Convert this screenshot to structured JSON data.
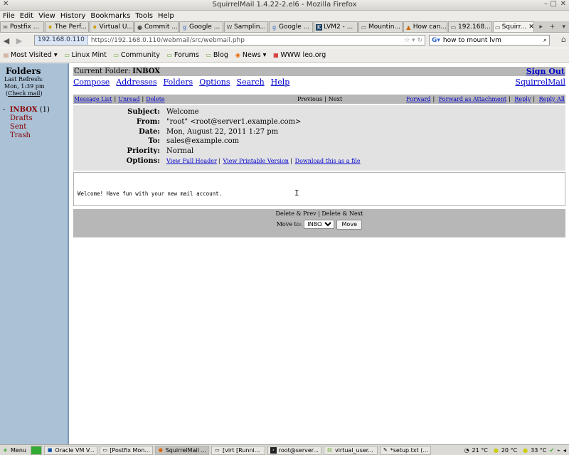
{
  "window": {
    "title": "SquirrelMail 1.4.22-2.el6 - Mozilla Firefox"
  },
  "menubar": {
    "items": [
      "File",
      "Edit",
      "View",
      "History",
      "Bookmarks",
      "Tools",
      "Help"
    ]
  },
  "tabs": [
    {
      "label": "Postfix ...",
      "icon": "postfix-icon"
    },
    {
      "label": "The Perf...",
      "icon": "bulb-icon"
    },
    {
      "label": "Virtual U...",
      "icon": "bulb-icon"
    },
    {
      "label": "Commit ...",
      "icon": "github-icon"
    },
    {
      "label": "Google ...",
      "icon": "google-icon"
    },
    {
      "label": "Samplin...",
      "icon": "wikipedia-icon"
    },
    {
      "label": "Google ...",
      "icon": "google-icon"
    },
    {
      "label": "LVM2 - ...",
      "icon": "k-icon"
    },
    {
      "label": "Mountin...",
      "icon": "page-icon"
    },
    {
      "label": "How can...",
      "icon": "warning-icon"
    },
    {
      "label": "192.168...",
      "icon": "page-icon"
    },
    {
      "label": "Squirr...",
      "icon": "page-icon",
      "active": true
    }
  ],
  "nav": {
    "host": "192.168.0.110",
    "url": "https://192.168.0.110/webmail/src/webmail.php",
    "search_value": "how to mount lvm"
  },
  "bookmarks": [
    "Most Visited",
    "Linux Mint",
    "Community",
    "Forums",
    "Blog",
    "News",
    "WWW leo.org"
  ],
  "sidebar": {
    "heading": "Folders",
    "last_refresh_label": "Last Refresh:",
    "last_refresh_time": "Mon, 1:39 pm",
    "check_mail": "Check mail",
    "folders": [
      "Drafts",
      "Sent",
      "Trash"
    ],
    "inbox": "INBOX",
    "inbox_count": "(1)"
  },
  "header": {
    "current_folder_label": "Current Folder:",
    "current_folder": "INBOX",
    "sign_out": "Sign Out",
    "brand": "SquirrelMail",
    "nav": [
      "Compose",
      "Addresses",
      "Folders",
      "Options",
      "Search",
      "Help"
    ]
  },
  "actions": {
    "message_list": "Message List",
    "unread": "Unread",
    "delete": "Delete",
    "previous": "Previous",
    "next": "Next",
    "forward": "Forward",
    "forward_attachment": "Forward as Attachment",
    "reply": "Reply",
    "reply_all": "Reply All"
  },
  "message": {
    "labels": {
      "subject": "Subject:",
      "from": "From:",
      "date": "Date:",
      "to": "To:",
      "priority": "Priority:",
      "options": "Options:"
    },
    "subject": "Welcome",
    "from": "\"root\" <root@server1.example.com>",
    "date": "Mon, August 22, 2011 1:27 pm",
    "to": "sales@example.com",
    "priority": "Normal",
    "options": [
      "View Full Header",
      "View Printable Version",
      "Download this as a file"
    ],
    "body": "Welcome! Have fun with your new mail account."
  },
  "bottom": {
    "delete_prev": "Delete & Prev",
    "delete_next": "Delete & Next",
    "move_to_label": "Move to:",
    "move_select_value": "INBOX",
    "move_button": "Move"
  },
  "taskbar": {
    "menu": "Menu",
    "items": [
      {
        "label": "Oracle VM V...",
        "icon": "vbox-icon"
      },
      {
        "label": "[Postfix Mon...",
        "icon": "window-icon"
      },
      {
        "label": "SquirrelMail ...",
        "icon": "firefox-icon",
        "active": true
      },
      {
        "label": "[virt [Runni...",
        "icon": "window-icon"
      },
      {
        "label": "root@server...",
        "icon": "terminal-icon"
      },
      {
        "label": "virtual_user...",
        "icon": "folder-icon"
      },
      {
        "label": "*setup.txt (...",
        "icon": "text-editor-icon"
      }
    ],
    "temps": [
      "21 °C",
      "20 °C",
      "33 °C"
    ]
  }
}
